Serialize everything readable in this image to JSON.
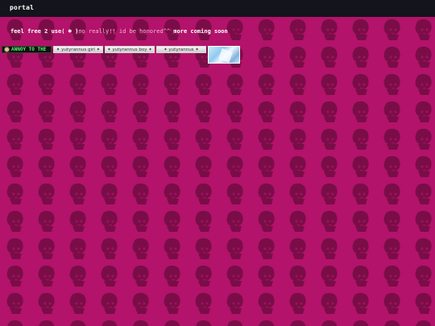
{
  "header": {
    "brand": "portal"
  },
  "intro": {
    "line_a": "feel free 2 use( ☻ )",
    "line_b": "no really!! id be honored^^",
    "line_c": " more coming soon"
  },
  "buttons": [
    {
      "label": "ANNOY TO THE"
    },
    {
      "label": "✦ yutyrannus girl ✦"
    },
    {
      "label": "✦ yutyrannus boy ✦"
    },
    {
      "label": "✦ yutyrannus ✦"
    }
  ],
  "colors": {
    "background": "#b3136a",
    "pattern": "#7a0c48",
    "topbar": "#14141c"
  }
}
